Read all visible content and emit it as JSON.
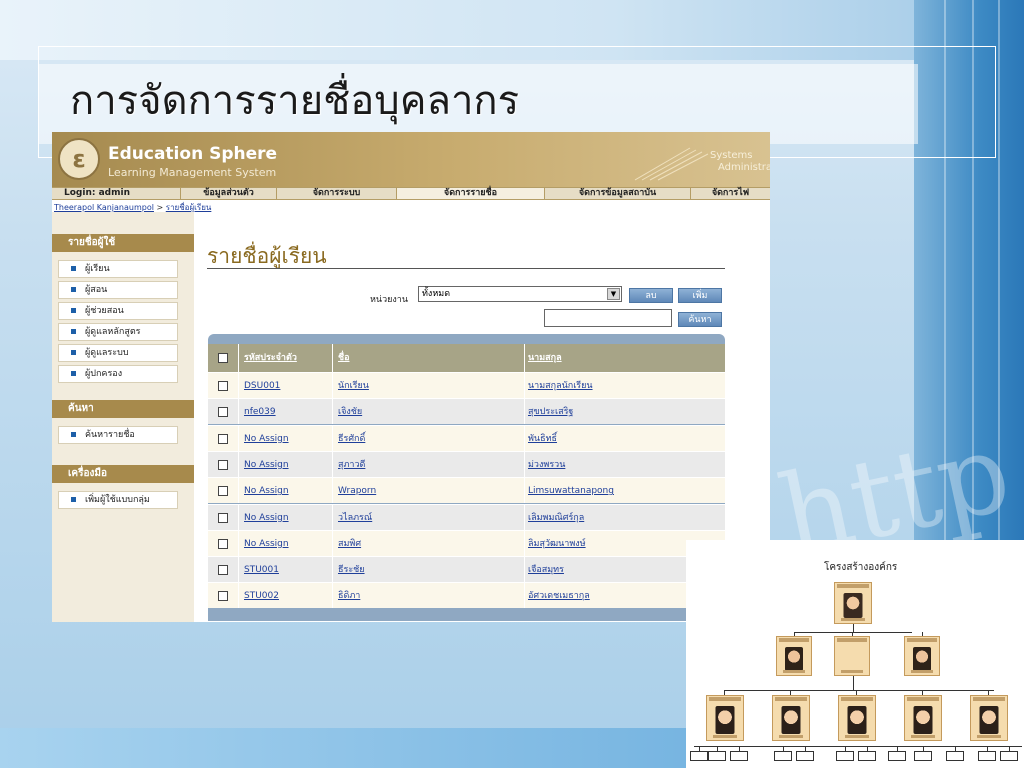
{
  "slide": {
    "title": "การจัดการรายชื่อบุคลากร"
  },
  "app": {
    "brand_name": "Education Sphere",
    "brand_sub": "Learning Management System",
    "system_line1": "Systems",
    "system_line2": "Administrato",
    "login": "Login: admin",
    "tabs": [
      "ข้อมูลส่วนตัว",
      "จัดการระบบ",
      "จัดการรายชื่อ",
      "จัดการข้อมูลสถาบัน",
      "จัดการไฟ"
    ],
    "active_tab_index": 2,
    "breadcrumb": {
      "user": "Theerapol Kanjanaumpol",
      "separator": ">",
      "page": "รายชื่อผู้เรียน"
    }
  },
  "sidebar": {
    "sections": [
      {
        "title": "รายชื่อผู้ใช้",
        "items": [
          "ผู้เรียน",
          "ผู้สอน",
          "ผู้ช่วยสอน",
          "ผู้ดูแลหลักสูตร",
          "ผู้ดูแลระบบ",
          "ผู้ปกครอง"
        ]
      },
      {
        "title": "ค้นหา",
        "items": [
          "ค้นหารายชื่อ"
        ]
      },
      {
        "title": "เครื่องมือ",
        "items": [
          "เพิ่มผู้ใช้แบบกลุ่ม"
        ]
      }
    ]
  },
  "content": {
    "title": "รายชื่อผู้เรียน",
    "unit_label": "หน่วยงาน",
    "unit_value": "ทั้งหมด",
    "delete_button": "ลบ",
    "add_button": "เพิ่ม",
    "search_button": "ค้นหา",
    "search_value": ""
  },
  "table": {
    "headers": [
      "รหัสประจำตัว",
      "ชื่อ",
      "นามสกุล"
    ],
    "rows": [
      [
        "DSU001",
        "นักเรียน",
        "นามสกุลนักเรียน"
      ],
      [
        "nfe039",
        "เจิงชัย",
        "สุขประเสริฐ"
      ],
      [
        "No Assign",
        "ธีรศักดิ์",
        "พันธิทธิ์"
      ],
      [
        "No Assign",
        "สุภาวดี",
        "ม่วงพรวน"
      ],
      [
        "No Assign",
        "Wraporn",
        "Limsuwattanapong"
      ],
      [
        "No Assign",
        "วไลภรณ์",
        "เลิมพมณิศร์กุล"
      ],
      [
        "No Assign",
        "สมพิศ",
        "ลิมสุวัฒนาพงษ์"
      ],
      [
        "STU001",
        "ธีระชัย",
        "เจือสมุทร"
      ],
      [
        "STU002",
        "ธิดิภา",
        "อัศวเดชเมธากุล"
      ]
    ]
  },
  "org_chart": {
    "title": "โครงสร้างองค์กร",
    "colors": {
      "card": "#f5dcae",
      "border": "#c49a5c"
    }
  },
  "colors": {
    "header_brown": "#a58a4f",
    "section_brown": "#a78a4c",
    "link_blue": "#1f3f9a",
    "grid_frame": "#8fa8c2",
    "grid_header": "#a7a487"
  }
}
